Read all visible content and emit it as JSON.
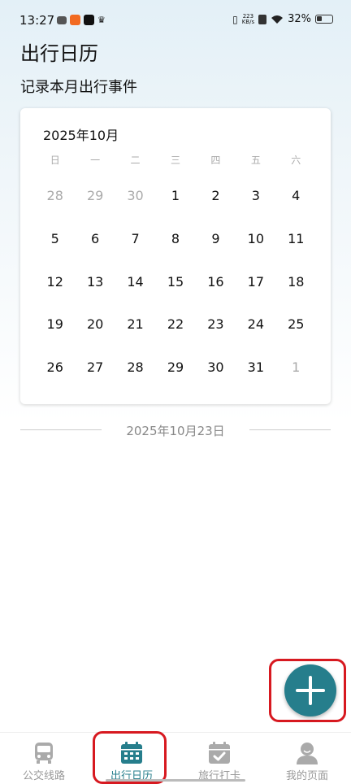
{
  "status_bar": {
    "time": "13:27",
    "net_speed_value": "223",
    "net_speed_unit": "KB/s",
    "battery": "32%"
  },
  "header": {
    "title": "出行日历",
    "subtitle": "记录本月出行事件"
  },
  "calendar": {
    "month_label": "2025年10月",
    "weekdays": [
      "日",
      "一",
      "二",
      "三",
      "四",
      "五",
      "六"
    ],
    "days": [
      {
        "d": "28",
        "other": true
      },
      {
        "d": "29",
        "other": true
      },
      {
        "d": "30",
        "other": true
      },
      {
        "d": "1",
        "other": false
      },
      {
        "d": "2",
        "other": false
      },
      {
        "d": "3",
        "other": false
      },
      {
        "d": "4",
        "other": false
      },
      {
        "d": "5",
        "other": false
      },
      {
        "d": "6",
        "other": false
      },
      {
        "d": "7",
        "other": false
      },
      {
        "d": "8",
        "other": false
      },
      {
        "d": "9",
        "other": false
      },
      {
        "d": "10",
        "other": false
      },
      {
        "d": "11",
        "other": false
      },
      {
        "d": "12",
        "other": false
      },
      {
        "d": "13",
        "other": false
      },
      {
        "d": "14",
        "other": false
      },
      {
        "d": "15",
        "other": false
      },
      {
        "d": "16",
        "other": false
      },
      {
        "d": "17",
        "other": false
      },
      {
        "d": "18",
        "other": false
      },
      {
        "d": "19",
        "other": false
      },
      {
        "d": "20",
        "other": false
      },
      {
        "d": "21",
        "other": false
      },
      {
        "d": "22",
        "other": false
      },
      {
        "d": "23",
        "other": false
      },
      {
        "d": "24",
        "other": false
      },
      {
        "d": "25",
        "other": false
      },
      {
        "d": "26",
        "other": false
      },
      {
        "d": "27",
        "other": false
      },
      {
        "d": "28",
        "other": false
      },
      {
        "d": "29",
        "other": false
      },
      {
        "d": "30",
        "other": false
      },
      {
        "d": "31",
        "other": false
      },
      {
        "d": "1",
        "other": true
      }
    ]
  },
  "selected_date": "2025年10月23日",
  "bottom_nav": {
    "items": [
      {
        "label": "公交线路",
        "icon": "bus-icon",
        "active": false
      },
      {
        "label": "出行日历",
        "icon": "calendar-icon",
        "active": true
      },
      {
        "label": "旅行打卡",
        "icon": "calendar-check-icon",
        "active": false
      },
      {
        "label": "我的页面",
        "icon": "person-icon",
        "active": false
      }
    ]
  },
  "colors": {
    "accent": "#267e8c",
    "highlight": "#d71920",
    "muted": "#aaaaaa"
  }
}
